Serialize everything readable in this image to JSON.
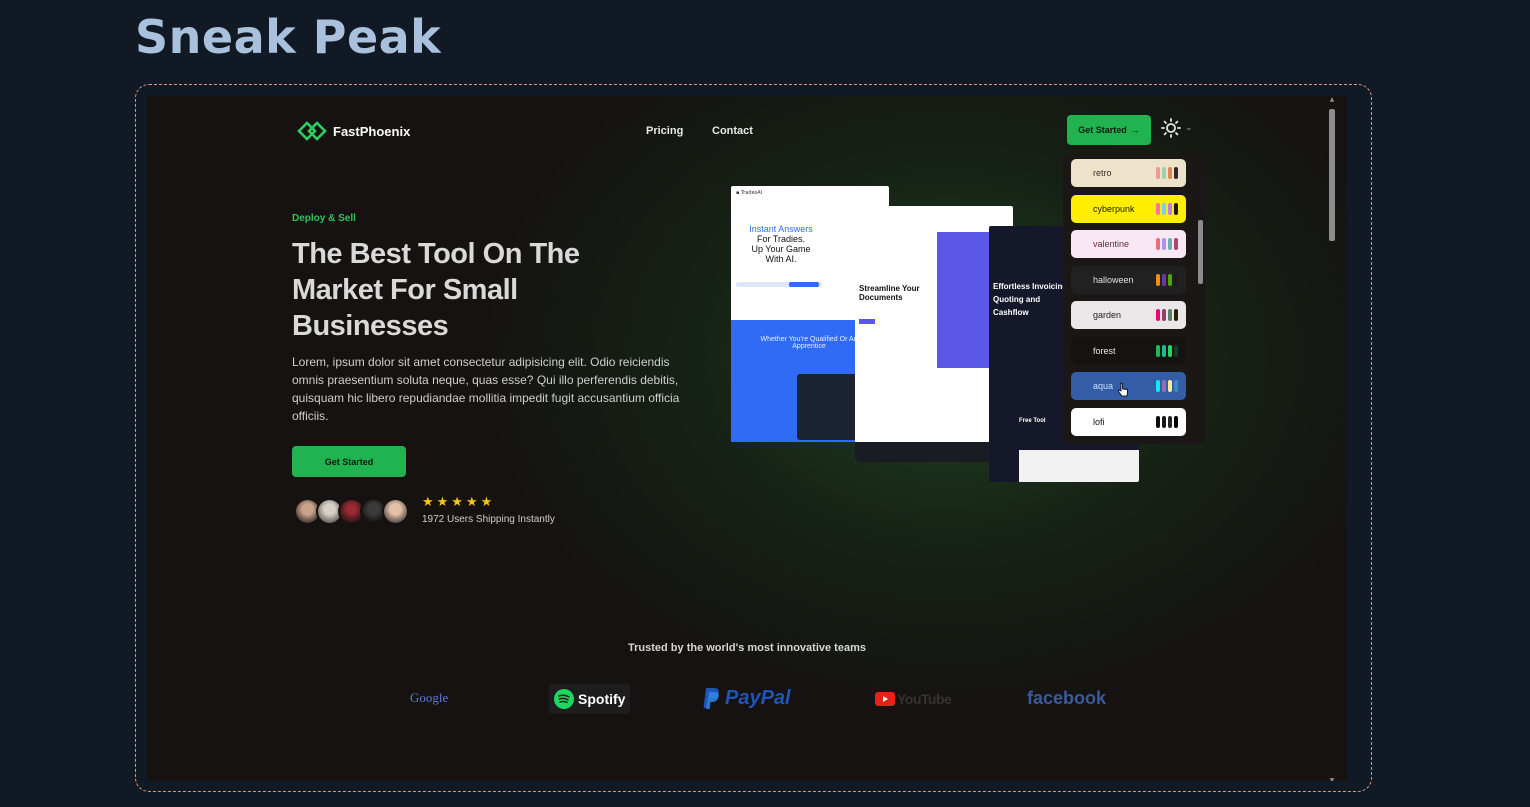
{
  "page_title": "Sneak Peak",
  "nav": {
    "logo": "FastPhoenix",
    "links": [
      "Pricing",
      "Contact"
    ],
    "cta": "Get Started",
    "cta_arrow": "→",
    "theme_icon": "sun-icon"
  },
  "hero": {
    "eyebrow": "Deploy & Sell",
    "headline": "The Best Tool On The Market For Small Businesses",
    "lede": "Lorem, ipsum dolor sit amet consectetur adipisicing elit. Odio reiciendis omnis praesentium soluta neque, quas esse? Qui illo perferendis debitis, quisquam hic libero repudiandae mollitia impedit fugit accusantium officia officiis.",
    "cta": "Get Started",
    "stars": "★★★★★",
    "rating": 5,
    "social_proof": "1972 Users Shipping Instantly"
  },
  "mockups": {
    "card_a_line1": "Instant Answers",
    "card_a_line2": "For Tradies.",
    "card_a_line3": "Up Your Game",
    "card_a_line4": "With AI.",
    "card_a_sub": "Whether You're Qualified Or An Apprentice",
    "card_b_title": "Streamline Your Documents",
    "card_c_title": "Effortless Invoicing, Quoting and Cashflow",
    "card_c_footer": "Free Tool"
  },
  "theme_menu": {
    "options": [
      {
        "name": "retro",
        "bg": "#ece3ca",
        "fg": "#3a2e2a",
        "swatches": [
          "#ef9995",
          "#a4cbb4",
          "#dc8850",
          "#2e282a"
        ]
      },
      {
        "name": "cyberpunk",
        "bg": "#ffee00",
        "fg": "#1a1a1a",
        "swatches": [
          "#ff7598",
          "#75d1f0",
          "#c07eec",
          "#1a1a1a"
        ]
      },
      {
        "name": "valentine",
        "bg": "#fae7f4",
        "fg": "#632c3b",
        "swatches": [
          "#e96d7b",
          "#a991f7",
          "#66b1b3",
          "#af4670"
        ]
      },
      {
        "name": "halloween",
        "bg": "#212121",
        "fg": "#e0e0e0",
        "swatches": [
          "#f28c18",
          "#6d3a9c",
          "#51a800",
          "#1b1d1d"
        ]
      },
      {
        "name": "garden",
        "bg": "#e9e7e7",
        "fg": "#1f1f1f",
        "swatches": [
          "#f40076",
          "#8e4162",
          "#5c7f67",
          "#291e00"
        ]
      },
      {
        "name": "forest",
        "bg": "#171212",
        "fg": "#e6e6e6",
        "swatches": [
          "#1eb854",
          "#1db990",
          "#1fd65f",
          "#19362d"
        ]
      },
      {
        "name": "aqua",
        "bg": "#345da7",
        "fg": "#c7e0ff",
        "swatches": [
          "#09ecf3",
          "#966fb3",
          "#ffe999",
          "#3b8ac4"
        ]
      },
      {
        "name": "lofi",
        "bg": "#ffffff",
        "fg": "#111111",
        "swatches": [
          "#0d0d0d",
          "#1a1919",
          "#262626",
          "#000000"
        ]
      }
    ]
  },
  "trusted": {
    "heading": "Trusted by the world's most innovative teams",
    "brands": [
      "Google",
      "Spotify",
      "PayPal",
      "YouTube",
      "facebook"
    ]
  },
  "colors": {
    "accent": "#21b34f",
    "bg": "#151211",
    "outer_bg": "#111a24"
  }
}
